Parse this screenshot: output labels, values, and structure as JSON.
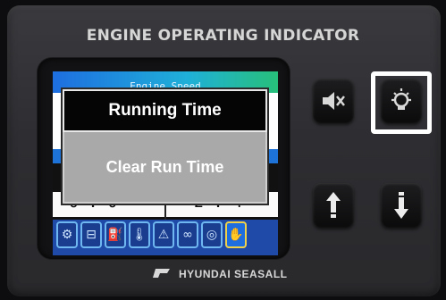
{
  "panel": {
    "title": "ENGINE OPERATING INDICATOR",
    "brand": "HYUNDAI SEASALL"
  },
  "screen": {
    "top_label": "Engine Speed",
    "readout_left": "0 : 0",
    "readout_right": "2 : 4",
    "status_icons": [
      {
        "name": "engine-icon",
        "glyph": "⚙",
        "active": false
      },
      {
        "name": "battery-icon",
        "glyph": "⊟",
        "active": false
      },
      {
        "name": "oil-can-icon",
        "glyph": "⛽",
        "active": false
      },
      {
        "name": "temperature-icon",
        "glyph": "🌡",
        "active": false
      },
      {
        "name": "warning-lamp-icon",
        "glyph": "⚠",
        "active": false
      },
      {
        "name": "glow-plug-icon",
        "glyph": "∞",
        "active": false
      },
      {
        "name": "filter-icon",
        "glyph": "◎",
        "active": false
      },
      {
        "name": "hand-icon",
        "glyph": "✋",
        "active": true
      }
    ]
  },
  "popup": {
    "header": "Running Time",
    "item": "Clear Run Time"
  },
  "buttons": {
    "mute": "mute-icon",
    "backlight": "backlight-icon",
    "up": "arrow-up-icon",
    "down": "arrow-down-icon"
  },
  "colors": {
    "highlight": "#ffffff",
    "popup_header_bg": "#050505",
    "popup_item_bg": "#a9a9a9",
    "screen_accent": "#1f4aa8"
  }
}
